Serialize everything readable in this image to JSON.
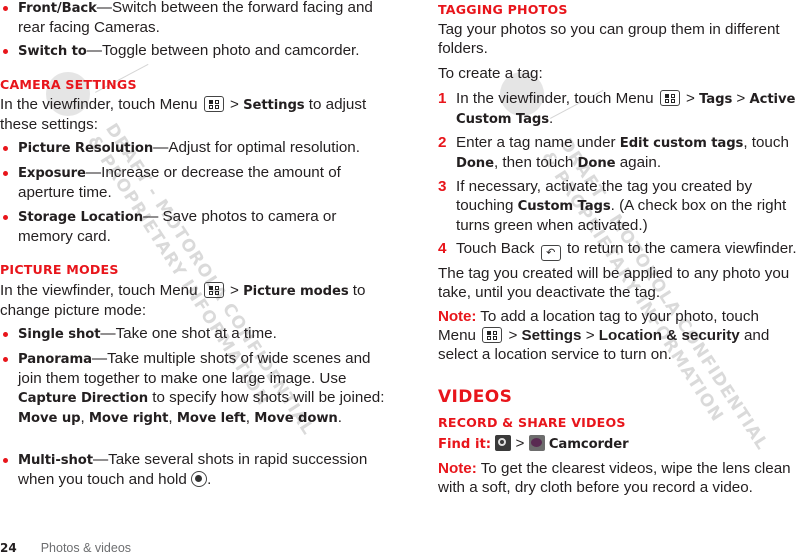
{
  "left": {
    "bullets_top": [
      {
        "term": "Front/Back",
        "text": "—Switch between the forward facing and rear facing Cameras."
      },
      {
        "term": "Switch to",
        "text": "—Toggle between photo and camcorder."
      }
    ],
    "camera_settings": {
      "heading": "CAMERA SETTINGS",
      "intro_pre": "In the viewfinder, touch Menu",
      "intro_sep": " > ",
      "intro_term": "Settings",
      "intro_post": " to adjust these settings:",
      "items": [
        {
          "term": "Picture Resolution",
          "text": "—Adjust for optimal resolution."
        },
        {
          "term": "Exposure",
          "text": "—Increase or decrease the amount of aperture time."
        },
        {
          "term": "Storage Location",
          "text": "— Save photos to camera or memory card."
        }
      ]
    },
    "picture_modes": {
      "heading": "PICTURE MODES",
      "intro_pre": "In the viewfinder, touch Menu",
      "intro_sep": " > ",
      "intro_term": "Picture modes",
      "intro_post": " to change picture mode:",
      "single": {
        "term": "Single shot",
        "text": "—Take one shot at a time."
      },
      "panorama": {
        "term": "Panorama",
        "text": "—Take multiple shots of wide scenes and join them together to make one large image. Use ",
        "capture": "Capture Direction",
        "text2": " to specify how shots will be joined: ",
        "dirs": [
          "Move up",
          "Move right",
          "Move left",
          "Move down"
        ],
        "sep": ", ",
        "end": "."
      },
      "multi": {
        "term": "Multi-shot",
        "text": "—Take several shots in rapid succession when you touch and hold ",
        "end": "."
      }
    }
  },
  "right": {
    "tagging": {
      "heading": "TAGGING PHOTOS",
      "intro": "Tag your photos so you can group them in different folders.",
      "to_create": "To create a tag:",
      "steps": [
        {
          "n": "1",
          "pre": "In the viewfinder, touch Menu",
          "sep": " > ",
          "t1": "Tags",
          "sep2": " > ",
          "t2": "Active Custom Tags",
          "end": "."
        },
        {
          "n": "2",
          "pre": "Enter a tag name under ",
          "t1": "Edit custom tags",
          "mid": ", touch ",
          "t2": "Done",
          "mid2": ", then touch ",
          "t3": "Done",
          "end": " again."
        },
        {
          "n": "3",
          "pre": "If necessary, activate the tag you created by touching ",
          "t1": "Custom Tags",
          "end": ". (A check box on the right turns green when activated.)"
        },
        {
          "n": "4",
          "pre": "Touch Back",
          "end": " to return to the camera viewfinder."
        }
      ],
      "applied": "The tag you created will be applied to any photo you take, until you deactivate the tag.",
      "note_label": "Note:",
      "note_pre": " To add a location tag to your photo, touch Menu",
      "note_sep": " > ",
      "note_t1": "Settings",
      "note_sep2": " > ",
      "note_t2": "Location & security",
      "note_end": " and select a location service to turn on."
    },
    "videos": {
      "heading": "VIDEOS",
      "sub": "RECORD & SHARE VIDEOS",
      "find_label": "Find it:",
      "find_sep": " > ",
      "find_target": "Camcorder",
      "note_label": "Note:",
      "note_text": " To get the clearest videos, wipe the lens clean with a soft, dry cloth before you record a video."
    }
  },
  "footer": {
    "page": "24",
    "section": "Photos & videos"
  },
  "watermark": {
    "line1": "DRAFT - MOTOROLA CONFIDENTIAL",
    "line2": "& PROPRIETARY INFORMATION"
  },
  "icons": {
    "menu": "menu-key-icon",
    "back": "↶",
    "shutter": "shutter-icon",
    "camera_app": "camera-app-icon",
    "camcorder_app": "camcorder-app-icon"
  },
  "colors": {
    "accent": "#e8151b",
    "text": "#231f20",
    "footer": "#6d6e70"
  }
}
